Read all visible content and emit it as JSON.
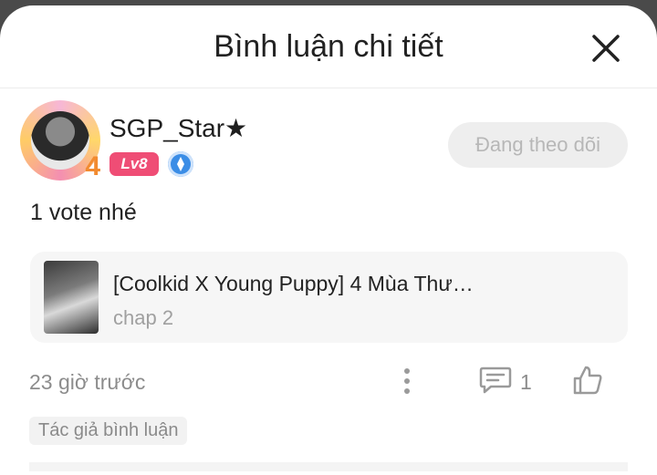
{
  "header": {
    "title": "Bình luận chi tiết",
    "close_icon": "close-icon"
  },
  "user": {
    "name": "SGP_Star★",
    "level": "Lv8",
    "avatar_badge": "4",
    "follow_label": "Đang theo dõi"
  },
  "comment": {
    "text": "1 vote nhé"
  },
  "story": {
    "title": "[Coolkid X Young Puppy] 4 Mùa Thư…",
    "chapter": "chap 2"
  },
  "meta": {
    "time": "23 giờ trước",
    "reply_count": "1"
  },
  "tag": {
    "label": "Tác giả bình luận"
  },
  "colors": {
    "level_badge": "#ef4d75",
    "verify_badge": "#3b8de6",
    "follow_bg": "#eeeeee"
  }
}
